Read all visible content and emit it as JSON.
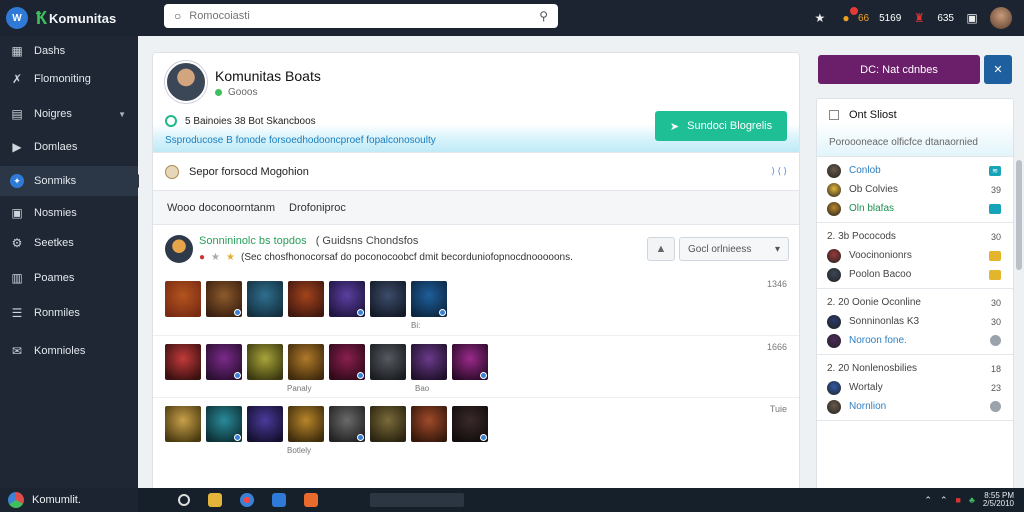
{
  "app": {
    "brand": "Komunitas",
    "logo_badge": "W"
  },
  "search": {
    "placeholder": "Romocoiasti"
  },
  "topbar": {
    "notif_count": "66",
    "label1": "5169",
    "label2": "635",
    "icons": [
      "star-icon",
      "bell-icon",
      "user-icon",
      "window-icon"
    ]
  },
  "sidebar": {
    "items": [
      {
        "label": "Dashs",
        "icon": "grid-icon"
      },
      {
        "label": "Flomoniting",
        "icon": "wrench-icon"
      },
      {
        "label": "Noigres",
        "icon": "doc-icon"
      },
      {
        "label": "Domlaes",
        "icon": "play-icon"
      },
      {
        "label": "Sonmiks",
        "icon": "shield-icon"
      },
      {
        "label": "Nosmies",
        "icon": "square-icon"
      },
      {
        "label": "Seetkes",
        "icon": "gear-icon"
      },
      {
        "label": "Poames",
        "icon": "bag-icon"
      },
      {
        "label": "Ronmiles",
        "icon": "list-icon"
      },
      {
        "label": "Komnioles",
        "icon": "mail-icon"
      }
    ],
    "footer_label": "Komumlit."
  },
  "profile": {
    "name": "Komunitas Boats",
    "subtitle": "Gooos",
    "stats": "5 Bainoies 38 Bot Skancboos",
    "description": "Ssproducose B fonode forsoedhodooncproef fopalconosoulty",
    "cta_label": "Sundoci Blogrelis"
  },
  "featured": {
    "label": "Sepor forsocd Mogohion",
    "right": "⟩ ⟨ ⟩"
  },
  "tabs": [
    "Wooo doconoorntanm",
    "Drofoniproc"
  ],
  "post": {
    "author": "Sonnininolc bs topdos",
    "author_meta": "( Guidsns Chondsfos",
    "byline": "(Sec chosfhonocorsaf do poconocoobcf dmit becorduniofopnocdnooooons."
  },
  "post_actions": {
    "dropdown_label": "Gocl orlnieess"
  },
  "grid_rows": [
    {
      "number": "1346",
      "caption": "Bi:",
      "cells": 7
    },
    {
      "number": "1666",
      "caption": "Panaly",
      "caption2": "Bao",
      "cells": 8
    },
    {
      "number": "Tuie",
      "caption": "Botlely",
      "cells": 8
    }
  ],
  "right_panel": {
    "primary_button": "DC: Nat cdnbes",
    "secondary_button": "✕",
    "title": "Ont Sliost",
    "subtitle": "Poroooneace olficfce dtanaornied",
    "sections": [
      [
        {
          "label": "Conlob",
          "tag": "≋",
          "style": "b"
        },
        {
          "label": "Ob Colvies",
          "tag": "39",
          "style": "n"
        },
        {
          "label": "Oln blafas",
          "tag": "",
          "style": "g"
        }
      ],
      [
        {
          "label": "2. 3b  Pococods",
          "tag": "30",
          "style": "n"
        },
        {
          "label": "Voocinonionrs",
          "tag": "",
          "style": "n"
        },
        {
          "label": "Poolon Bacoo",
          "tag": "",
          "style": "n"
        }
      ],
      [
        {
          "label": "2. 20  Oonie Oconline",
          "tag": "30",
          "style": "n"
        },
        {
          "label": "Sonninonlas K3",
          "tag": "30",
          "style": "n"
        },
        {
          "label": "Noroon fone.",
          "tag": "",
          "style": "b"
        }
      ],
      [
        {
          "label": "2. 20  Nonlenosbilies",
          "tag": "18",
          "style": "n"
        },
        {
          "label": "Wortaly",
          "tag": "23",
          "style": "n"
        },
        {
          "label": "Nornlion",
          "tag": "",
          "style": "b"
        }
      ]
    ]
  },
  "taskbar": {
    "clock_time": "8:55 PM",
    "clock_date": "2/5/2010"
  }
}
